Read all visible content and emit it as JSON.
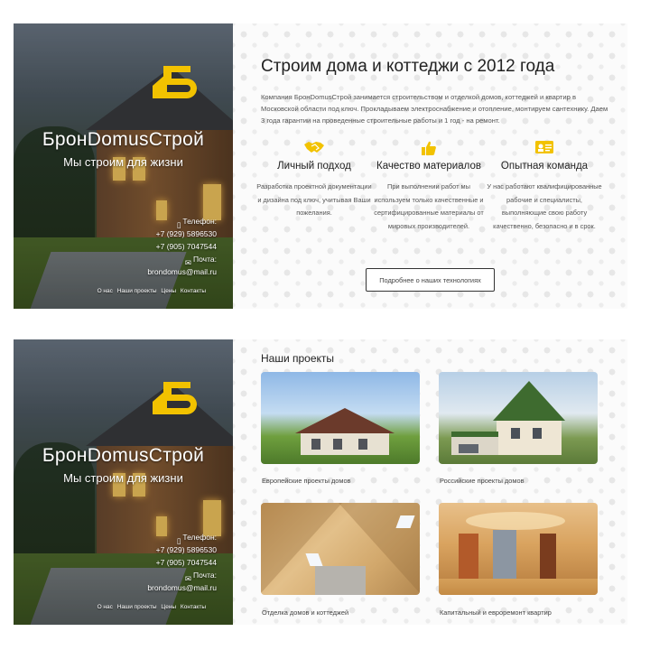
{
  "hero": {
    "brand": "БронDomusСтрой",
    "tagline": "Мы строим для жизни",
    "phone_label": "Телефон:",
    "phone1": "+7 (929) 5896530",
    "phone2": "+7 (905) 7047544",
    "mail_label": "Почта:",
    "email": "brondomus@mail.ru",
    "nav": [
      "О нас",
      "Наши проекты",
      "Цены",
      "Контакты"
    ]
  },
  "about": {
    "title": "Строим дома и коттеджи с 2012 года",
    "intro": "Компания БронDomusСтрой занимается строительством и отделкой домов, коттеджей и квартир в Московской области под ключ. Прокладываем электроснабжение и отопление, монтируем сантехнику. Даем 3 года гарантии на проведенные строительные работы и 1 год - на ремонт.",
    "features": [
      {
        "icon": "handshake-icon",
        "title": "Личный подход",
        "desc": "Разработка проектной документации и дизайна под ключ, учитывая Ваши пожелания."
      },
      {
        "icon": "thumbs-up-icon",
        "title": "Качество материалов",
        "desc": "При выполнении работ мы используем только качественные и сертифицированные материалы от мировых производителей."
      },
      {
        "icon": "id-card-icon",
        "title": "Опытная команда",
        "desc": "У нас работают квалифицированные рабочие и специалисты, выполняющие свою работу качественно, безопасно и в срок."
      }
    ],
    "more_button": "Подробнее о наших технологиях"
  },
  "projects": {
    "title": "Наши проекты",
    "items": [
      {
        "label": "Европейские проекты домов"
      },
      {
        "label": "Российские проекты домов"
      },
      {
        "label": "Отделка домов и коттеджей"
      },
      {
        "label": "Капитальный и евроремонт квартир"
      }
    ]
  },
  "colors": {
    "accent": "#f2c200",
    "text": "#222222",
    "muted": "#555555"
  }
}
